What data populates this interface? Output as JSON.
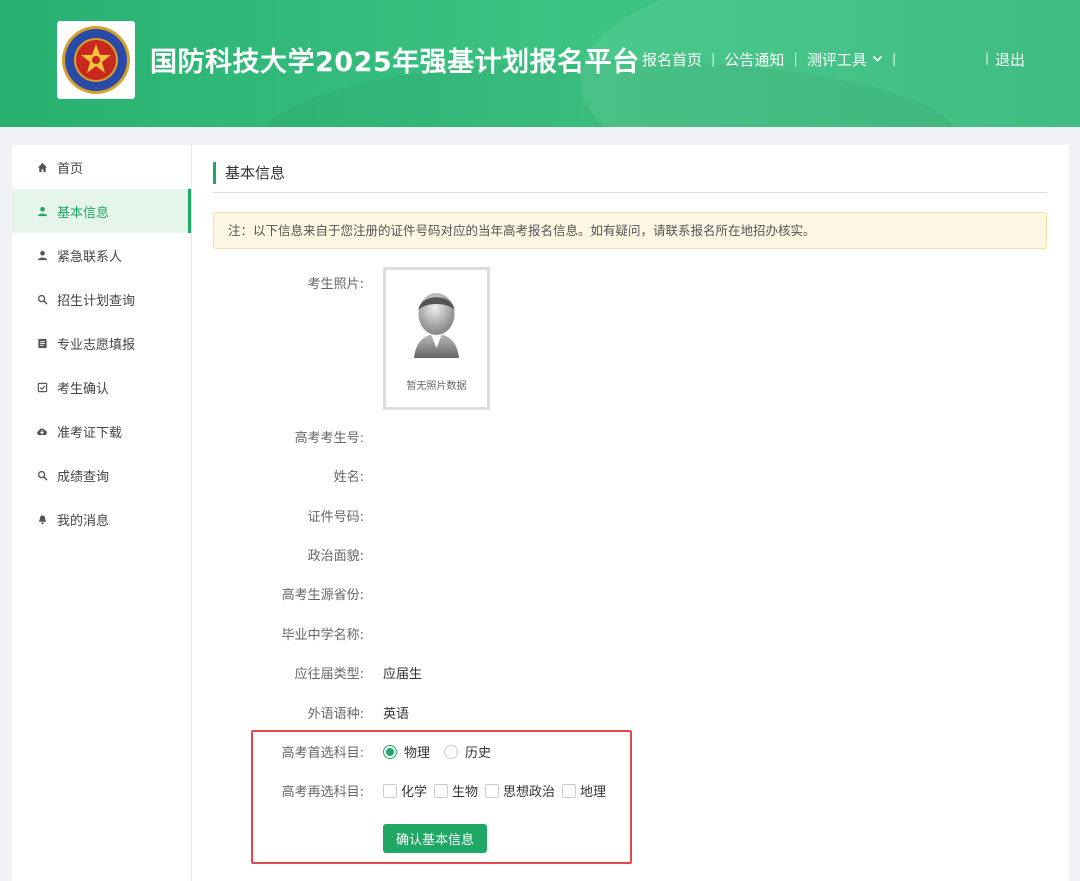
{
  "header": {
    "title": "国防科技大学2025年强基计划报名平台",
    "nav": [
      "报名首页",
      "公告通知",
      "测评工具"
    ],
    "logout": "退出"
  },
  "sidebar": {
    "items": [
      {
        "label": "首页",
        "icon": "home-icon"
      },
      {
        "label": "基本信息",
        "icon": "user-icon",
        "active": true
      },
      {
        "label": "紧急联系人",
        "icon": "user-icon"
      },
      {
        "label": "招生计划查询",
        "icon": "search-icon"
      },
      {
        "label": "专业志愿填报",
        "icon": "document-icon"
      },
      {
        "label": "考生确认",
        "icon": "checkbox-icon"
      },
      {
        "label": "准考证下载",
        "icon": "cloud-download-icon"
      },
      {
        "label": "成绩查询",
        "icon": "search-icon"
      },
      {
        "label": "我的消息",
        "icon": "bell-icon"
      }
    ]
  },
  "main": {
    "section_title": "基本信息",
    "notice": "注：以下信息来自于您注册的证件号码对应的当年高考报名信息。如有疑问，请联系报名所在地招办核实。",
    "photo_label": "考生照片:",
    "photo_placeholder": "暂无照片数据",
    "fields": [
      {
        "label": "高考考生号:",
        "value": ""
      },
      {
        "label": "姓名:",
        "value": ""
      },
      {
        "label": "证件号码:",
        "value": ""
      },
      {
        "label": "政治面貌:",
        "value": ""
      },
      {
        "label": "高考生源省份:",
        "value": ""
      },
      {
        "label": "毕业中学名称:",
        "value": ""
      },
      {
        "label": "应往届类型:",
        "value": "应届生"
      },
      {
        "label": "外语语种:",
        "value": "英语"
      }
    ],
    "first_subject": {
      "label": "高考首选科目:",
      "options": [
        "物理",
        "历史"
      ],
      "selected": "物理"
    },
    "second_subject": {
      "label": "高考再选科目:",
      "options": [
        "化学",
        "生物",
        "思想政治",
        "地理"
      ]
    },
    "confirm_button": "确认基本信息"
  },
  "colors": {
    "accent": "#1fa863",
    "header_gradient_start": "#27b070",
    "highlight_border": "#e04a4a",
    "notice_bg": "#fdf6e3"
  }
}
